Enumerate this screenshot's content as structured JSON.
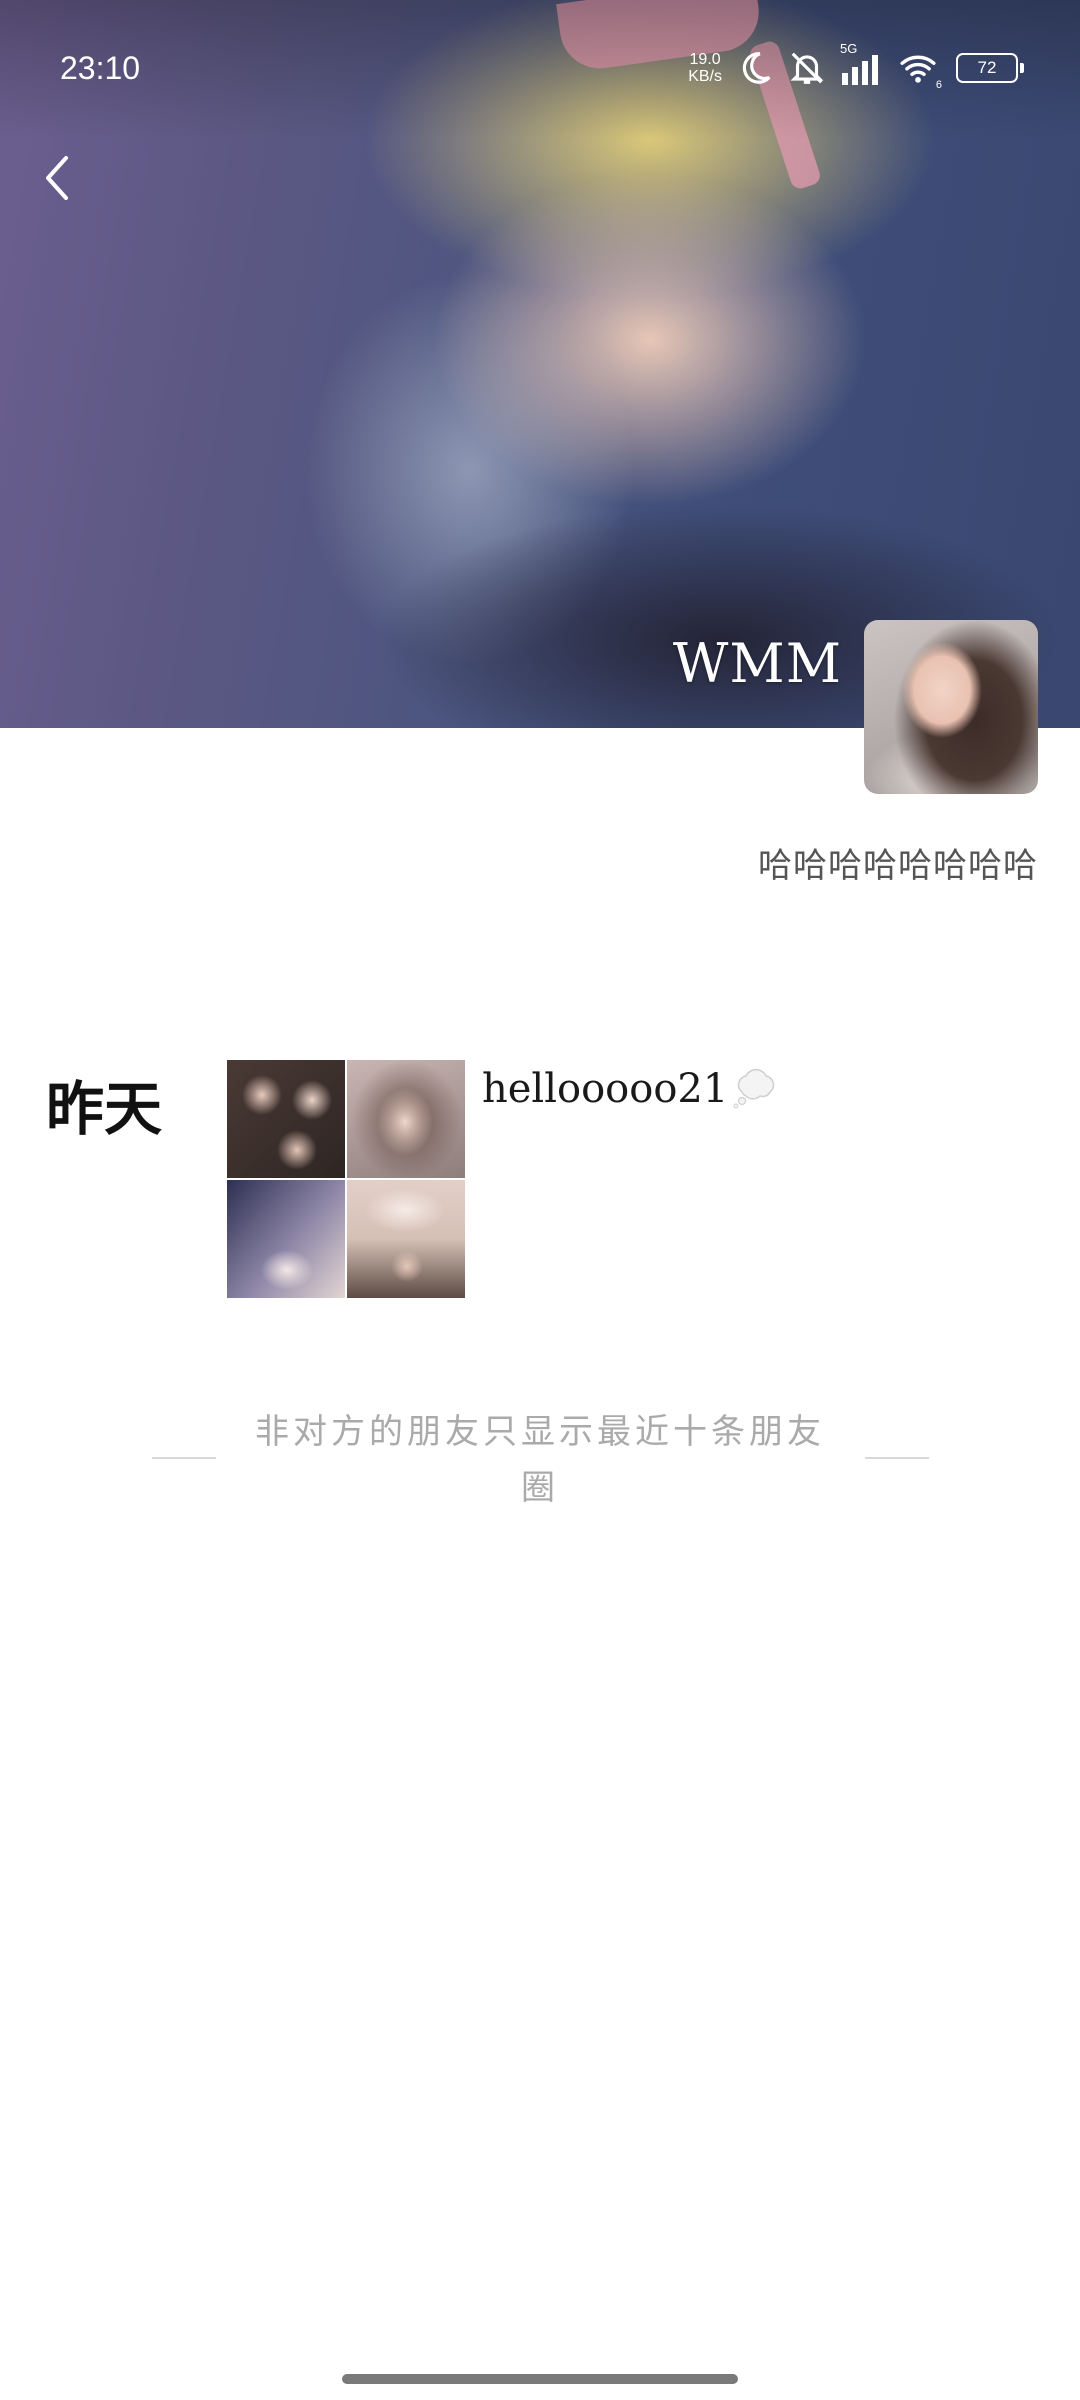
{
  "status_bar": {
    "time": "23:10",
    "net_speed_value": "19.0",
    "net_speed_unit": "KB/s",
    "network_type": "5G",
    "wifi_badge": "6",
    "battery_level": "72",
    "icons": [
      "moon-icon",
      "mute-bell-icon",
      "cell-signal-icon",
      "wifi-icon",
      "battery-icon"
    ]
  },
  "header": {
    "back_icon": "chevron-left-icon",
    "profile_name": "WMM"
  },
  "profile": {
    "signature": "哈哈哈哈哈哈哈哈"
  },
  "posts": [
    {
      "date_label": "昨天",
      "text": "hellooooo21",
      "emoji_icon": "thought-bubble-icon",
      "photo_count": 4
    }
  ],
  "footer": {
    "limit_note": "非对方的朋友只显示最近十条朋友圈"
  },
  "colors": {
    "accent_text": "#111111",
    "muted_text": "#aaaaaa",
    "bio_text": "#555555"
  }
}
